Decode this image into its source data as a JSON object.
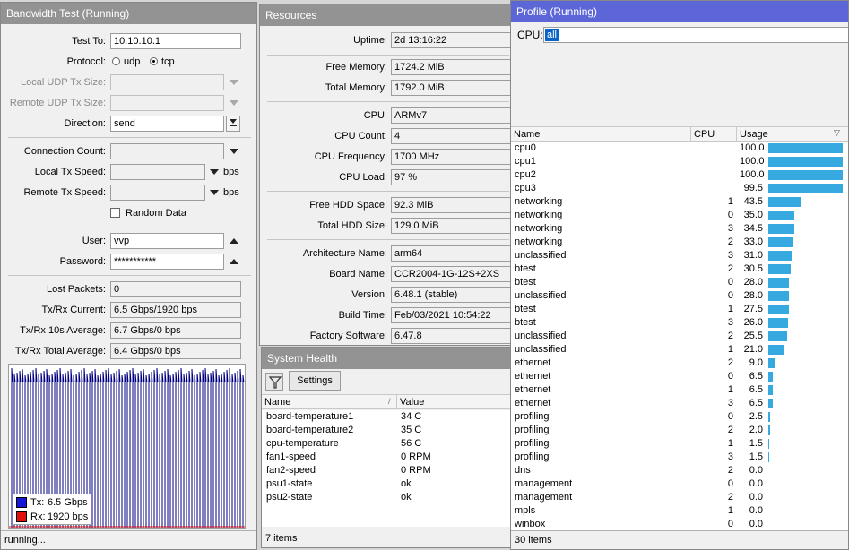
{
  "bandwidth": {
    "title": "Bandwidth Test (Running)",
    "test_to_label": "Test To:",
    "test_to": "10.10.10.1",
    "protocol_label": "Protocol:",
    "protocol_udp": "udp",
    "protocol_tcp": "tcp",
    "protocol_selected": "tcp",
    "local_udp_label": "Local UDP Tx Size:",
    "remote_udp_label": "Remote UDP Tx Size:",
    "direction_label": "Direction:",
    "direction": "send",
    "conn_count_label": "Connection Count:",
    "local_tx_label": "Local Tx Speed:",
    "local_tx_unit": "bps",
    "remote_tx_label": "Remote Tx Speed:",
    "remote_tx_unit": "bps",
    "random_data_label": "Random Data",
    "user_label": "User:",
    "user": "vvp",
    "password_label": "Password:",
    "password": "***********",
    "lost_label": "Lost Packets:",
    "lost": "0",
    "current_label": "Tx/Rx Current:",
    "current": "6.5 Gbps/1920 bps",
    "avg10_label": "Tx/Rx 10s Average:",
    "avg10": "6.7 Gbps/0 bps",
    "total_avg_label": "Tx/Rx Total Average:",
    "total_avg": "6.4 Gbps/0 bps",
    "legend_tx_label": "Tx:",
    "legend_tx": "6.5 Gbps",
    "legend_rx_label": "Rx:",
    "legend_rx": "1920 bps",
    "status": "running...",
    "colors": {
      "tx": "#1616d8",
      "rx": "#e01010",
      "graph_line": "#000080"
    }
  },
  "resources": {
    "title": "Resources",
    "rows": [
      {
        "label": "Uptime:",
        "value": "2d 13:16:22"
      },
      {
        "label": "Free Memory:",
        "value": "1724.2 MiB"
      },
      {
        "label": "Total Memory:",
        "value": "1792.0 MiB"
      },
      {
        "label": "CPU:",
        "value": "ARMv7"
      },
      {
        "label": "CPU Count:",
        "value": "4"
      },
      {
        "label": "CPU Frequency:",
        "value": "1700 MHz"
      },
      {
        "label": "CPU Load:",
        "value": "97 %"
      },
      {
        "label": "Free HDD Space:",
        "value": "92.3 MiB"
      },
      {
        "label": "Total HDD Size:",
        "value": "129.0 MiB"
      },
      {
        "label": "Architecture Name:",
        "value": "arm64"
      },
      {
        "label": "Board Name:",
        "value": "CCR2004-1G-12S+2XS"
      },
      {
        "label": "Version:",
        "value": "6.48.1 (stable)"
      },
      {
        "label": "Build Time:",
        "value": "Feb/03/2021 10:54:22"
      },
      {
        "label": "Factory Software:",
        "value": "6.47.8"
      }
    ]
  },
  "health": {
    "title": "System Health",
    "filter_icon": "filter-icon",
    "settings_label": "Settings",
    "col_name": "Name",
    "col_value": "Value",
    "rows": [
      {
        "name": "board-temperature1",
        "value": "34 C"
      },
      {
        "name": "board-temperature2",
        "value": "35 C"
      },
      {
        "name": "cpu-temperature",
        "value": "56 C"
      },
      {
        "name": "fan1-speed",
        "value": "0 RPM"
      },
      {
        "name": "fan2-speed",
        "value": "0 RPM"
      },
      {
        "name": "psu1-state",
        "value": "ok"
      },
      {
        "name": "psu2-state",
        "value": "ok"
      }
    ],
    "count": "7 items"
  },
  "profile": {
    "title": "Profile (Running)",
    "cpu_label": "CPU:",
    "cpu_value": "all",
    "col_name": "Name",
    "col_cpu": "CPU",
    "col_usage": "Usage",
    "rows": [
      {
        "name": "cpu0",
        "cpu": "",
        "usage": "100.0",
        "pct": 100.0
      },
      {
        "name": "cpu1",
        "cpu": "",
        "usage": "100.0",
        "pct": 100.0
      },
      {
        "name": "cpu2",
        "cpu": "",
        "usage": "100.0",
        "pct": 100.0
      },
      {
        "name": "cpu3",
        "cpu": "",
        "usage": "99.5",
        "pct": 99.5
      },
      {
        "name": "networking",
        "cpu": "1",
        "usage": "43.5",
        "pct": 43.5
      },
      {
        "name": "networking",
        "cpu": "0",
        "usage": "35.0",
        "pct": 35.0
      },
      {
        "name": "networking",
        "cpu": "3",
        "usage": "34.5",
        "pct": 34.5
      },
      {
        "name": "networking",
        "cpu": "2",
        "usage": "33.0",
        "pct": 33.0
      },
      {
        "name": "unclassified",
        "cpu": "3",
        "usage": "31.0",
        "pct": 31.0
      },
      {
        "name": "btest",
        "cpu": "2",
        "usage": "30.5",
        "pct": 30.5
      },
      {
        "name": "btest",
        "cpu": "0",
        "usage": "28.0",
        "pct": 28.0
      },
      {
        "name": "unclassified",
        "cpu": "0",
        "usage": "28.0",
        "pct": 28.0
      },
      {
        "name": "btest",
        "cpu": "1",
        "usage": "27.5",
        "pct": 27.5
      },
      {
        "name": "btest",
        "cpu": "3",
        "usage": "26.0",
        "pct": 26.0
      },
      {
        "name": "unclassified",
        "cpu": "2",
        "usage": "25.5",
        "pct": 25.5
      },
      {
        "name": "unclassified",
        "cpu": "1",
        "usage": "21.0",
        "pct": 21.0
      },
      {
        "name": "ethernet",
        "cpu": "2",
        "usage": "9.0",
        "pct": 9.0
      },
      {
        "name": "ethernet",
        "cpu": "0",
        "usage": "6.5",
        "pct": 6.5
      },
      {
        "name": "ethernet",
        "cpu": "1",
        "usage": "6.5",
        "pct": 6.5
      },
      {
        "name": "ethernet",
        "cpu": "3",
        "usage": "6.5",
        "pct": 6.5
      },
      {
        "name": "profiling",
        "cpu": "0",
        "usage": "2.5",
        "pct": 2.5
      },
      {
        "name": "profiling",
        "cpu": "2",
        "usage": "2.0",
        "pct": 2.0
      },
      {
        "name": "profiling",
        "cpu": "1",
        "usage": "1.5",
        "pct": 1.5
      },
      {
        "name": "profiling",
        "cpu": "3",
        "usage": "1.5",
        "pct": 1.5
      },
      {
        "name": "dns",
        "cpu": "2",
        "usage": "0.0",
        "pct": 0.0
      },
      {
        "name": "management",
        "cpu": "0",
        "usage": "0.0",
        "pct": 0.0
      },
      {
        "name": "management",
        "cpu": "2",
        "usage": "0.0",
        "pct": 0.0
      },
      {
        "name": "mpls",
        "cpu": "1",
        "usage": "0.0",
        "pct": 0.0
      },
      {
        "name": "winbox",
        "cpu": "0",
        "usage": "0.0",
        "pct": 0.0
      }
    ],
    "count": "30 items",
    "colors": {
      "bar": "#36a9e1",
      "selection": "#0a64c8"
    }
  }
}
